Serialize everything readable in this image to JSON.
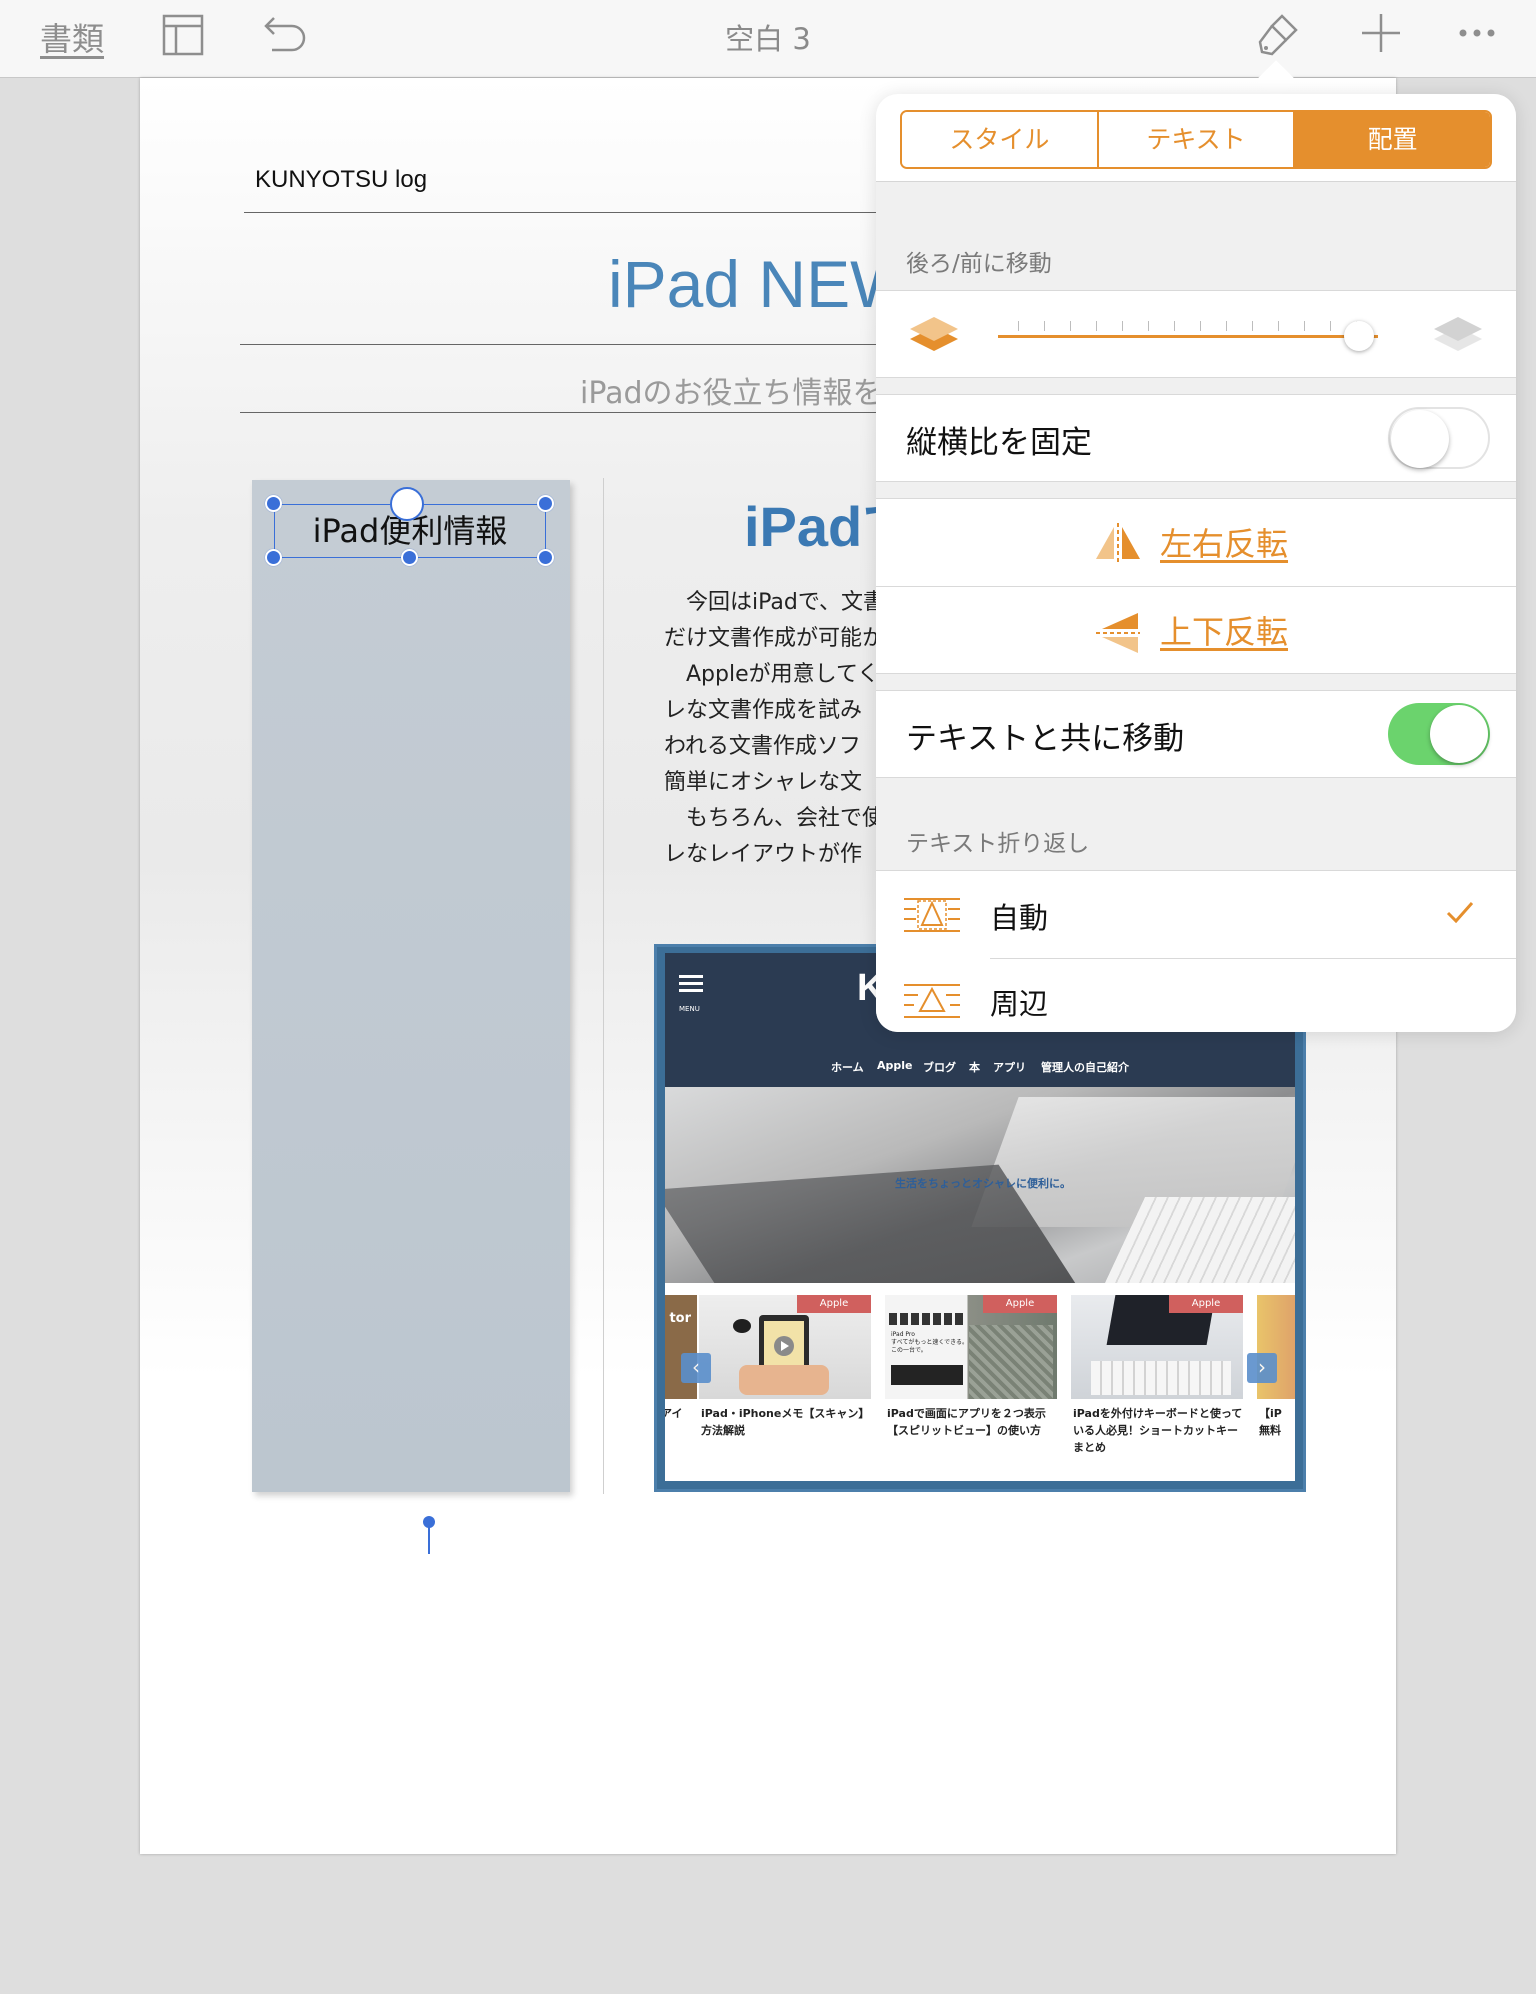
{
  "toolbar": {
    "documents_label": "書類",
    "title": "空白 3"
  },
  "page": {
    "blog_name": "KUNYOTSU log",
    "headline": "iPad NEW",
    "subtitle": "iPadのお役立ち情報を",
    "sidebar_text": "iPad便利情報",
    "article_title": "iPadで",
    "article_lines": [
      "　今回はiPadで、文書",
      "だけ文書作成が可能か",
      "　Appleが用意してく",
      "レな文書作成を試み",
      "われる文書作成ソフ",
      "簡単にオシャレな文",
      "　もちろん、会社で使",
      "レなレイアウトが作"
    ]
  },
  "screenshot": {
    "menu_label": "MENU",
    "site_letter": "K",
    "nav": [
      "ホーム",
      "Apple",
      "ブログ",
      "本",
      "アプリ",
      "管理人の自己紹介"
    ],
    "hero_text": "生活をちょっとオシャレに便利に。",
    "cards": [
      {
        "badge": "Apple",
        "caption": "iPad・iPhoneメモ【スキャン】方法解説"
      },
      {
        "badge": "Apple",
        "caption": "iPadで画面にアプリを２つ表示【スピリットビュー】の使い方"
      },
      {
        "badge": "Apple",
        "caption": "iPadを外付けキーボードと使っている人必見！ショートカットキーまとめ"
      }
    ],
    "left_partial": "アイ\n!",
    "right_partial": "【iP\n無料",
    "left_tag": "tor",
    "card_sub_text": "iPad Pro\nすべてがもっと速くできる。\nこの一台で。",
    "prev_arrow": "‹",
    "next_arrow": "›"
  },
  "popover": {
    "tabs": [
      {
        "label": "スタイル",
        "active": false
      },
      {
        "label": "テキスト",
        "active": false
      },
      {
        "label": "配置",
        "active": true
      }
    ],
    "arrange_section": "後ろ/前に移動",
    "arrange_level": 0.95,
    "lock_aspect_label": "縦横比を固定",
    "lock_aspect_on": false,
    "flip_horizontal": "左右反転",
    "flip_vertical": "上下反転",
    "move_with_text_label": "テキストと共に移動",
    "move_with_text_on": true,
    "wrap_section": "テキスト折り返し",
    "wrap_options": [
      {
        "label": "自動",
        "selected": true
      },
      {
        "label": "周辺",
        "selected": false
      }
    ]
  },
  "colors": {
    "accent": "#e58f2d",
    "switch_on": "#6bd36d",
    "selection": "#3a6fd8",
    "title_blue": "#4a86b9"
  }
}
